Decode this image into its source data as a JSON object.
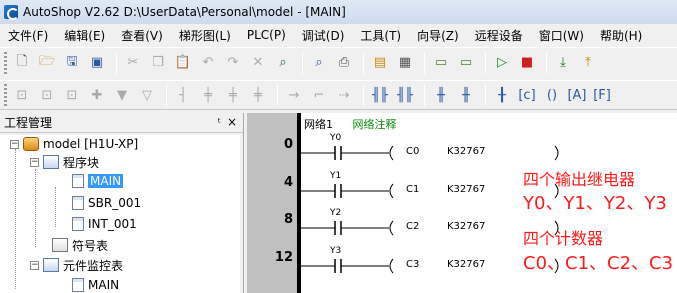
{
  "window": {
    "title": "AutoShop V2.62  D:\\UserData\\Personal\\model - [MAIN]"
  },
  "menu": [
    {
      "label": "文件(F)"
    },
    {
      "label": "编辑(E)"
    },
    {
      "label": "查看(V)"
    },
    {
      "label": "梯形图(L)"
    },
    {
      "label": "PLC(P)"
    },
    {
      "label": "调试(D)"
    },
    {
      "label": "工具(T)"
    },
    {
      "label": "向导(Z)"
    },
    {
      "label": "远程设备"
    },
    {
      "label": "窗口(W)"
    },
    {
      "label": "帮助(H)"
    }
  ],
  "panel": {
    "title": "工程管理",
    "pin": "ᵗ",
    "close": "×",
    "tree": {
      "root": "model [H1U-XP]",
      "program_block": "程序块",
      "main": "MAIN",
      "sbr": "SBR_001",
      "int": "INT_001",
      "symbols": "符号表",
      "monitor": "元件监控表",
      "monitor_main": "MAIN"
    }
  },
  "editor": {
    "net_label": "网络1",
    "net_comment": "网络注释",
    "rungs": [
      {
        "step": "0",
        "contact": "Y0",
        "coil": "C0",
        "value": "K32767"
      },
      {
        "step": "4",
        "contact": "Y1",
        "coil": "C1",
        "value": "K32767"
      },
      {
        "step": "8",
        "contact": "Y2",
        "coil": "C2",
        "value": "K32767"
      },
      {
        "step": "12",
        "contact": "Y3",
        "coil": "C3",
        "value": "K32767"
      }
    ]
  },
  "annotations": {
    "line1": "四个输出继电器",
    "line2": "Y0、Y1、Y2、Y3",
    "line3": "四个计数器",
    "line4": "C0、C1、C2、C3"
  },
  "colors": {
    "annotation": "#ff1a1a",
    "net_comment": "#0a8a0a",
    "selection": "#3399ff"
  },
  "toolbar_icons": [
    "new-file-icon",
    "open-file-icon",
    "save-icon",
    "save-all-icon",
    "cut-icon",
    "copy-icon",
    "paste-icon",
    "undo-icon",
    "redo-icon",
    "delete-icon",
    "find-icon",
    "print-preview-icon",
    "print-icon",
    "window-layout-icon",
    "list-view-icon",
    "monitor-icon",
    "monitor-edit-icon",
    "run-icon",
    "stop-icon",
    "download-icon",
    "upload-icon"
  ]
}
